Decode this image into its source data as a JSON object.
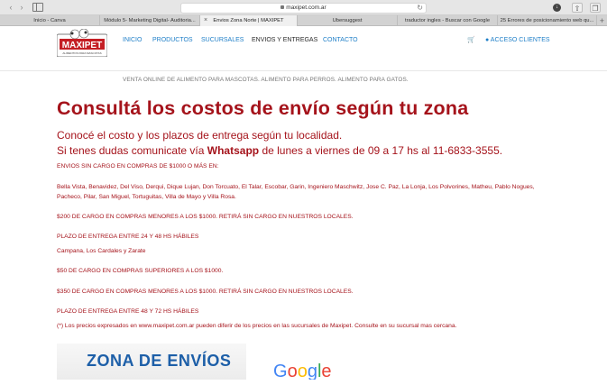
{
  "browser": {
    "url": "maxipet.com.ar",
    "tabs": [
      {
        "label": "Inicio - Canva"
      },
      {
        "label": "Módulo 5- Marketing Digital- Auditoria..."
      },
      {
        "label": "Envios Zona Norte | MAXIPET"
      },
      {
        "label": "Ubersuggest"
      },
      {
        "label": "traductor ingles - Buscar con Google"
      },
      {
        "label": "25 Errores de posicionamiento web qu..."
      }
    ]
  },
  "header": {
    "logo_text": "MAXIPET",
    "logo_sub": "ALIMENTOS PARA MASCOTAS",
    "nav": [
      "INICIO",
      "PRODUCTOS",
      "SUCURSALES",
      "ENVIOS Y ENTREGAS",
      "CONTACTO"
    ],
    "acceso": "ACCESO CLIENTES"
  },
  "content": {
    "tagline": "VENTA ONLINE DE ALIMENTO PARA MASCOTAS. ALIMENTO PARA PERROS. ALIMENTO PARA GATOS.",
    "title": "Consultá los costos de envío según tu zona",
    "subtitle1": "Conocé el costo y los plazos de entrega según tu localidad.",
    "subtitle2_pre": "Si tenes dudas comunicate vía ",
    "subtitle2_bold": "Whatsapp",
    "subtitle2_post": " de lunes a viernes de 09 a 17 hs al 11-6833-3555.",
    "free_shipping": "ENVIOS SIN CARGO EN COMPRAS DE $1000 O MÁS EN:",
    "zone1_list": "Bella Vista, Benavidez, Del Viso, Derqui, Dique Lujan, Don Torcuato, El Talar, Escobar, Garin, Ingeniero Maschwitz, Jose C. Paz, La Lonja, Los Polvorines, Matheu, Pablo Nogues, Pacheco, Pilar, San Miguel, Tortuguitas, Villa de Mayo y Villa Rosa.",
    "zone1_cost": "$200 DE CARGO EN COMPRAS MENORES A LOS $1000. RETIRÁ SIN CARGO EN NUESTROS LOCALES.",
    "zone1_term": "PLAZO DE ENTREGA ENTRE 24 Y 48 HS HÁBILES",
    "zone2_list": "Campana, Los Cardales y Zarate",
    "zone2_cost_high": "$50 DE CARGO EN COMPRAS SUPERIORES A LOS $1000.",
    "zone2_cost_low": "$350 DE CARGO EN COMPRAS MENORES A LOS $1000. RETIRÁ SIN CARGO EN NUESTROS LOCALES.",
    "zone2_term": "PLAZO DE ENTREGA ENTRE 48 Y 72 HS HÁBILES",
    "disclaimer": "(*) Los precios expresados en www.maxipet.com.ar pueden diferir de los precios en las sucursales de Maxipet. Consulte en su sucursal mas cercana.",
    "banner_text": "ZONA DE ENVÍOS",
    "google_text": "Google"
  }
}
